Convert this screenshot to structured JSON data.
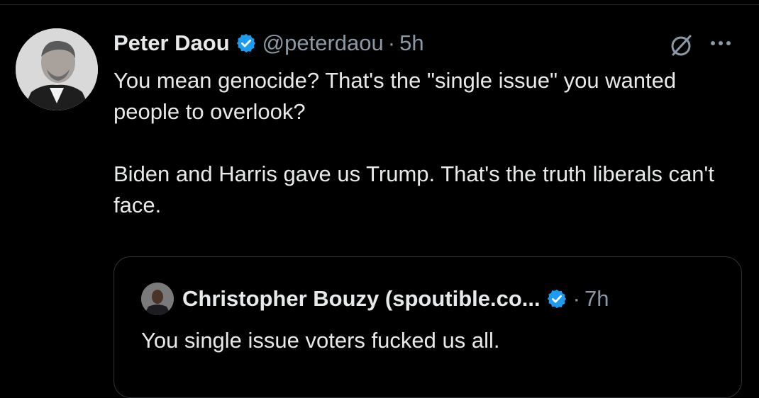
{
  "tweet": {
    "author_name": "Peter Daou",
    "handle": "@peterdaou",
    "separator": "·",
    "time": "5h",
    "paragraphs": [
      "You mean genocide? That's the \"single issue\" you wanted people to overlook?",
      "Biden and Harris gave us Trump. That's the truth liberals can't face."
    ]
  },
  "quoted_tweet": {
    "author_name": "Christopher Bouzy (spoutible.co...",
    "separator": "·",
    "time": "7h",
    "text": "You single issue voters fucked us all."
  },
  "icons": {
    "verified": "verified-badge-icon",
    "grok": "grok-icon",
    "more": "more-options-icon"
  },
  "colors": {
    "background": "#000000",
    "text": "#e7e9ea",
    "secondary_text": "#8b98a5",
    "verified_blue": "#1d9bf0",
    "border": "#2f3336"
  }
}
